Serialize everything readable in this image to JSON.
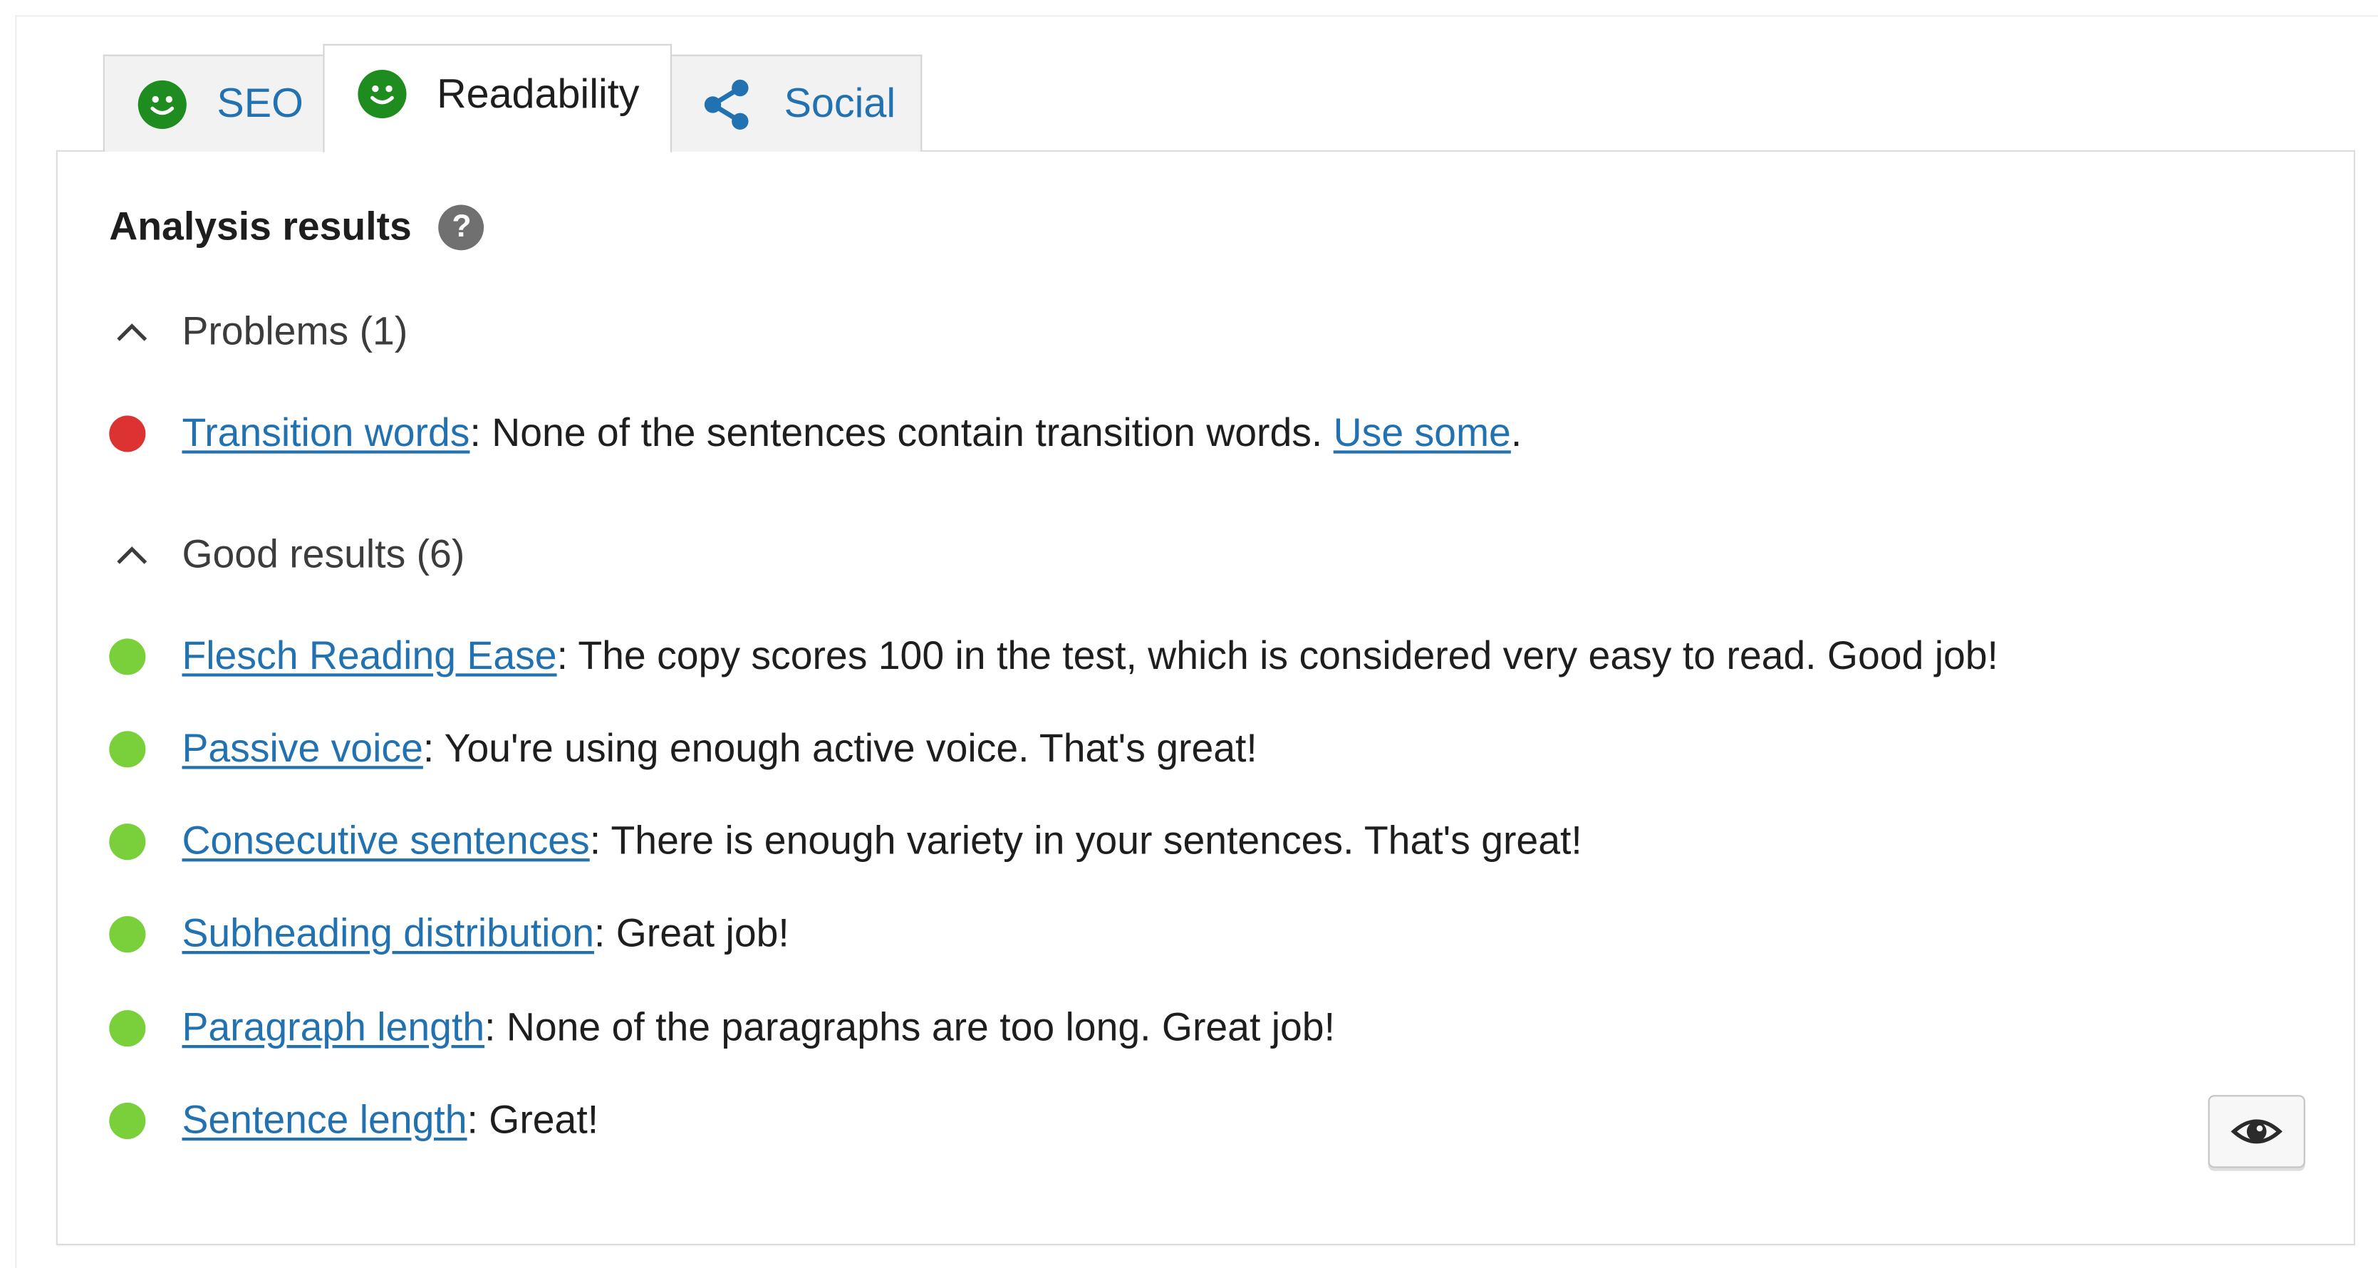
{
  "tabs": [
    {
      "label": "SEO",
      "icon": "smiley-icon",
      "active": false
    },
    {
      "label": "Readability",
      "icon": "smiley-icon",
      "active": true
    },
    {
      "label": "Social",
      "icon": "share-icon",
      "active": false
    }
  ],
  "analysis": {
    "title": "Analysis results",
    "help_icon": "?",
    "problems": {
      "header": "Problems (1)",
      "items": [
        {
          "link": "Transition words",
          "text": ": None of the sentences contain transition words. ",
          "extra_link": "Use some",
          "end": "."
        }
      ]
    },
    "good": {
      "header": "Good results (6)",
      "items": [
        {
          "link": "Flesch Reading Ease",
          "text": ": The copy scores 100 in the test, which is considered very easy to read. Good job!"
        },
        {
          "link": "Passive voice",
          "text": ": You're using enough active voice. That's great!"
        },
        {
          "link": "Consecutive sentences",
          "text": ": There is enough variety in your sentences. That's great!"
        },
        {
          "link": "Subheading distribution",
          "text": ": Great job!"
        },
        {
          "link": "Paragraph length",
          "text": ": None of the paragraphs are too long. Great job!"
        },
        {
          "link": "Sentence length",
          "text": ": Great!"
        }
      ]
    }
  },
  "colors": {
    "link": "#2271b1",
    "bad": "#dc3232",
    "good": "#7ad03a",
    "smiley": "#1e8c1e"
  },
  "eye_button_icon": "eye-icon"
}
